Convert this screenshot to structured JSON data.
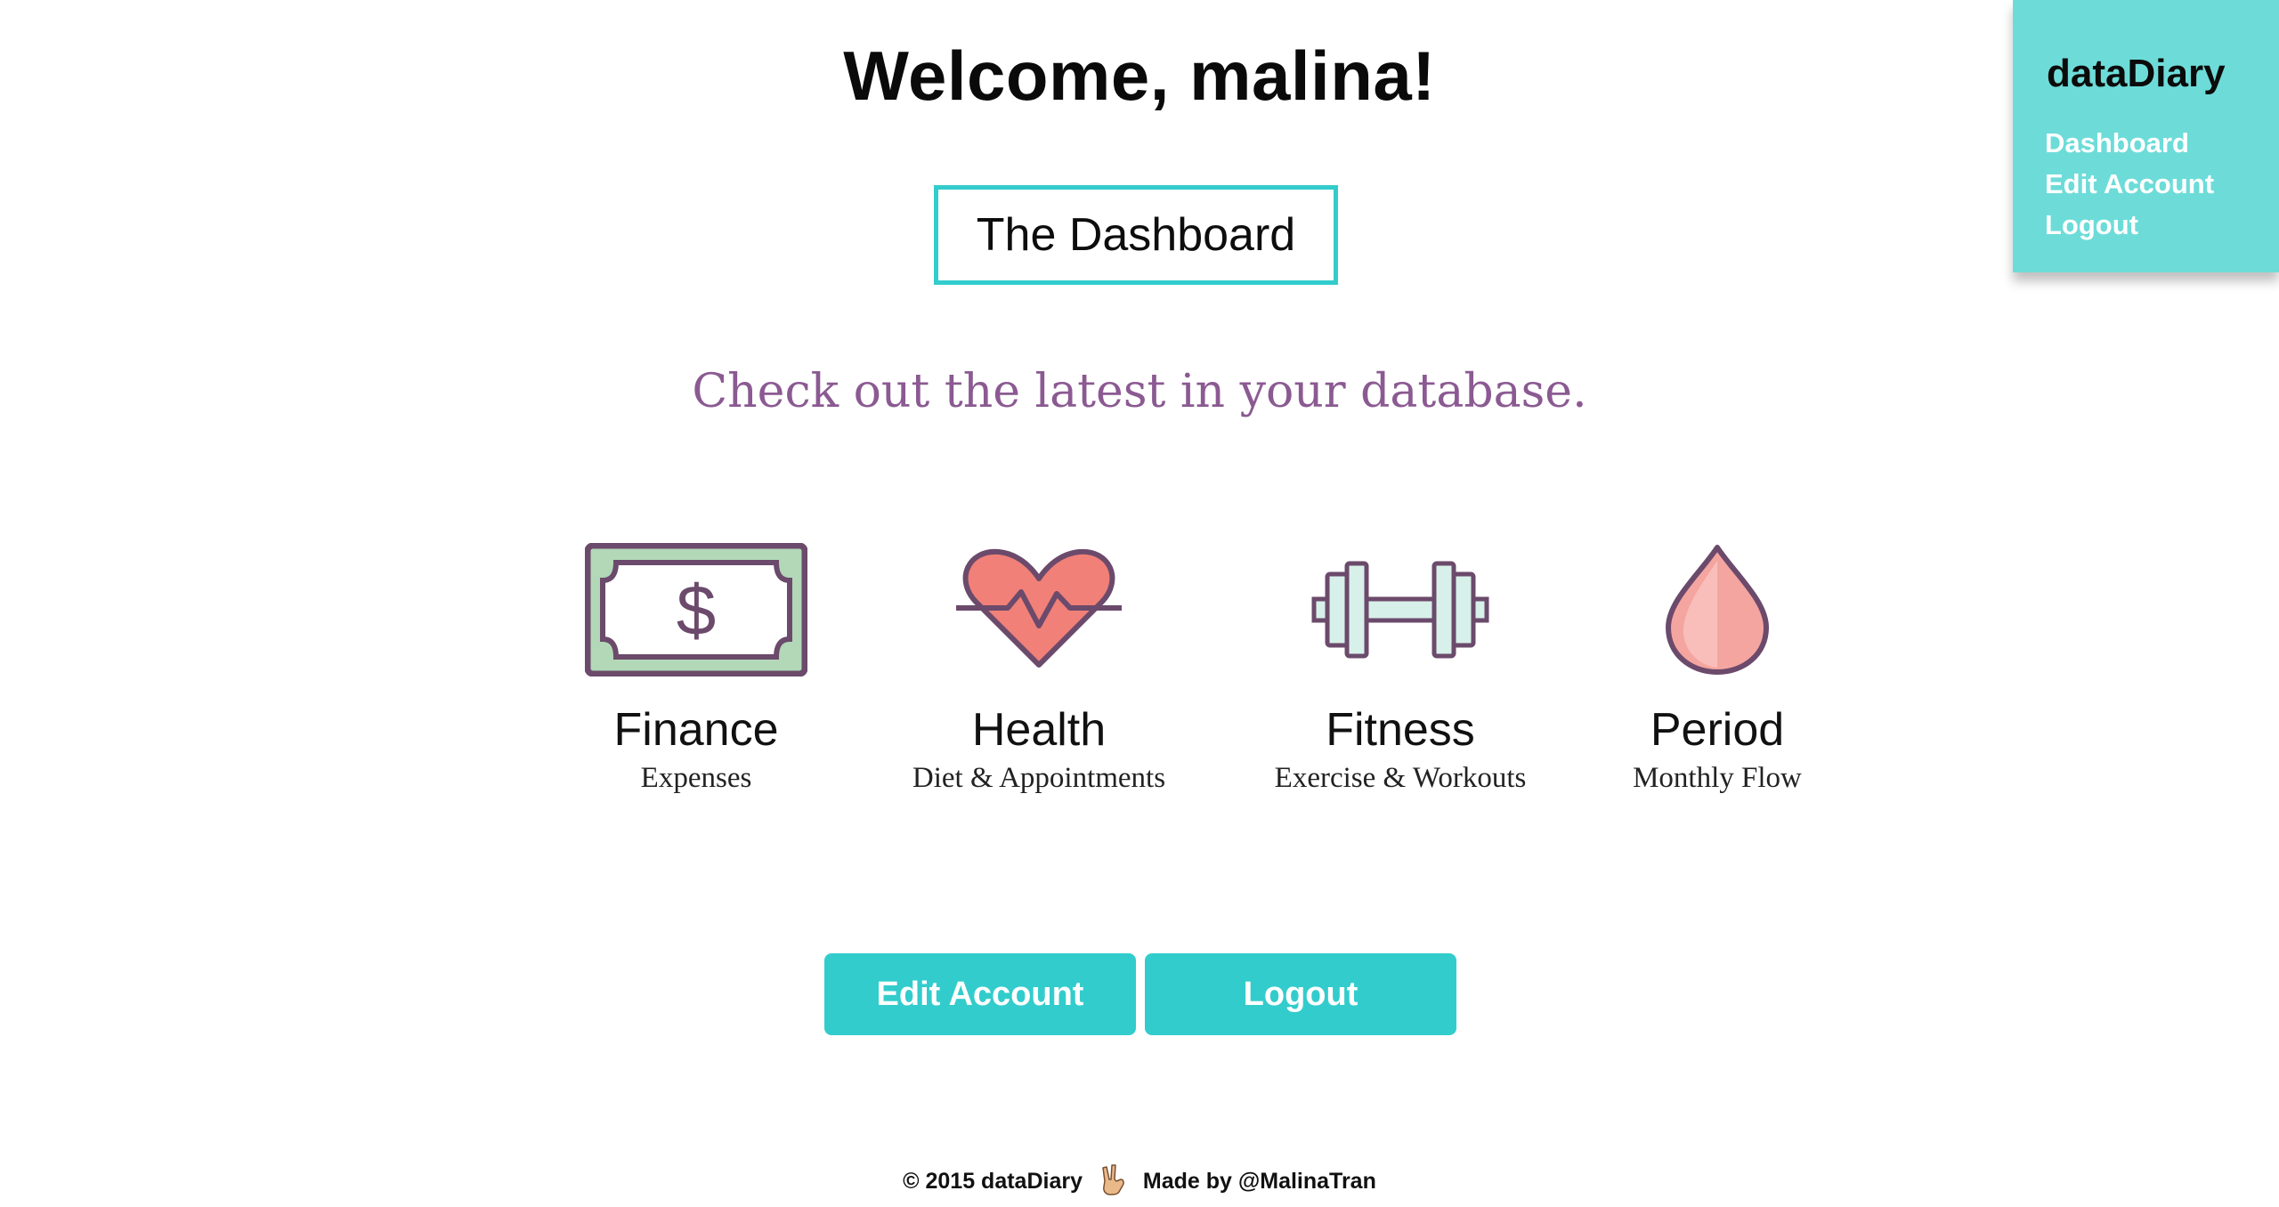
{
  "header": {
    "welcome": "Welcome, malina!",
    "dashboard_label": "The Dashboard",
    "tagline": "Check out the latest in your database."
  },
  "categories": [
    {
      "title": "Finance",
      "subtitle": "Expenses",
      "icon": "money-bill-icon"
    },
    {
      "title": "Health",
      "subtitle": "Diet & Appointments",
      "icon": "heart-pulse-icon"
    },
    {
      "title": "Fitness",
      "subtitle": "Exercise & Workouts",
      "icon": "dumbbell-icon"
    },
    {
      "title": "Period",
      "subtitle": "Monthly Flow",
      "icon": "drop-icon"
    }
  ],
  "actions": {
    "edit_account": "Edit Account",
    "logout": "Logout"
  },
  "sidebar": {
    "brand": "dataDiary",
    "items": [
      {
        "label": "Dashboard"
      },
      {
        "label": "Edit Account"
      },
      {
        "label": "Logout"
      }
    ]
  },
  "footer": {
    "copyright": "© 2015 dataDiary",
    "made_by": "Made by @MalinaTran"
  },
  "colors": {
    "accent": "#33cccc",
    "sidebar_bg": "#6ddcd8",
    "tagline": "#8b5a92",
    "icon_outline": "#6b4a6b",
    "money_green": "#b2d8b8",
    "heart_coral": "#f08078",
    "drop_pink": "#f4a5a0"
  }
}
